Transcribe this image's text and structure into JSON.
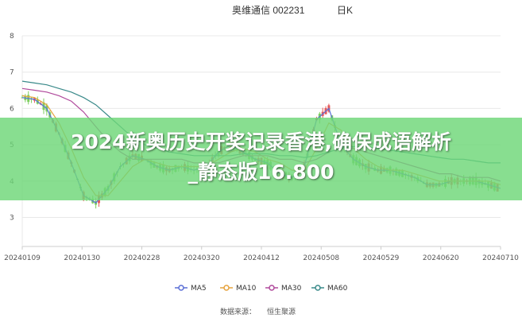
{
  "chart_data": {
    "type": "line",
    "title": "奥维通信 002231",
    "period": "日K",
    "x_ticks": [
      "20240109",
      "20240130",
      "20240228",
      "20240320",
      "20240412",
      "20240508",
      "20240529",
      "20240620",
      "20240710"
    ],
    "y_ticks": [
      "3",
      "4",
      "5",
      "6",
      "7",
      "8"
    ],
    "ylim": [
      2.2,
      8.0
    ],
    "grid": true,
    "legend_position": "bottom",
    "series": [
      {
        "name": "MA5",
        "color": "#5b6fd6",
        "values": [
          6.3,
          6.25,
          6.0,
          5.3,
          4.5,
          3.6,
          3.4,
          3.8,
          4.4,
          4.7,
          4.6,
          4.4,
          4.3,
          4.4,
          4.3,
          4.4,
          4.8,
          5.0,
          4.8,
          4.6,
          4.5,
          4.2,
          4.1,
          4.4,
          5.7,
          6.0,
          5.0,
          4.6,
          4.4,
          4.3,
          4.3,
          4.2,
          4.1,
          3.9,
          3.9,
          4.0,
          4.0,
          4.0,
          3.9,
          3.8
        ]
      },
      {
        "name": "MA10",
        "color": "#e6a23c",
        "values": [
          6.35,
          6.3,
          6.1,
          5.6,
          4.9,
          4.1,
          3.6,
          3.6,
          4.0,
          4.4,
          4.6,
          4.5,
          4.4,
          4.4,
          4.4,
          4.4,
          4.6,
          4.8,
          4.9,
          4.8,
          4.6,
          4.5,
          4.3,
          4.3,
          4.9,
          5.6,
          5.4,
          4.9,
          4.6,
          4.4,
          4.3,
          4.3,
          4.2,
          4.1,
          4.0,
          4.0,
          4.0,
          4.0,
          4.0,
          3.9
        ]
      },
      {
        "name": "MA30",
        "color": "#b04a9c",
        "values": [
          6.55,
          6.5,
          6.45,
          6.35,
          6.2,
          5.9,
          5.5,
          5.1,
          4.8,
          4.6,
          4.6,
          4.6,
          4.6,
          4.6,
          4.5,
          4.5,
          4.5,
          4.6,
          4.7,
          4.7,
          4.7,
          4.6,
          4.6,
          4.5,
          4.6,
          4.8,
          4.9,
          4.9,
          4.8,
          4.7,
          4.6,
          4.5,
          4.4,
          4.3,
          4.2,
          4.2,
          4.1,
          4.1,
          4.1,
          4.0
        ]
      },
      {
        "name": "MA60",
        "color": "#3a8a8a",
        "values": [
          6.75,
          6.7,
          6.65,
          6.55,
          6.45,
          6.3,
          6.1,
          5.8,
          5.5,
          5.2,
          5.0,
          4.9,
          4.8,
          4.75,
          4.7,
          4.7,
          4.7,
          4.7,
          4.75,
          4.75,
          4.75,
          4.7,
          4.7,
          4.65,
          4.7,
          4.8,
          4.9,
          4.95,
          4.95,
          4.9,
          4.85,
          4.8,
          4.75,
          4.7,
          4.65,
          4.6,
          4.6,
          4.55,
          4.5,
          4.5
        ]
      }
    ],
    "source_label": "数据来源：",
    "source_value": "恒生聚源"
  },
  "banner": {
    "line1": "2024新奥历史开奖记录香港,确保成语解析",
    "line2": "_静态版16.800"
  },
  "colors": {
    "up": "#e55a5a",
    "down": "#7dce5f",
    "grid": "#e8e8e8",
    "axis": "#cccccc"
  }
}
